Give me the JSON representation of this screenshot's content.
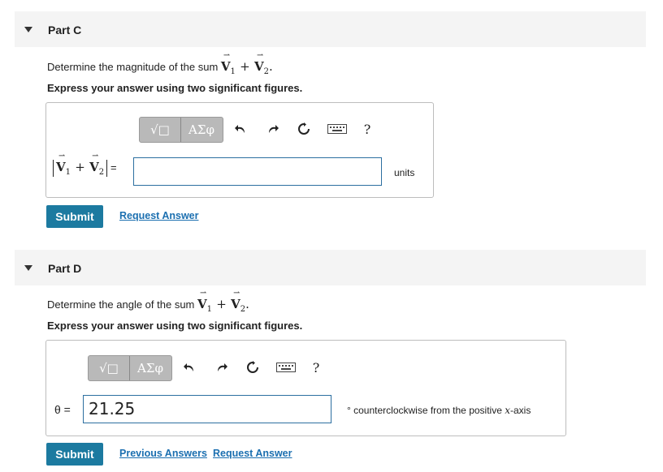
{
  "partC": {
    "title": "Part C",
    "prompt_prefix": "Determine the magnitude of the sum",
    "instruction": "Express your answer using two significant figures.",
    "toolbar": {
      "sqrt_label": "√□",
      "greek_label": "ΑΣφ",
      "help_label": "?"
    },
    "input_value": "",
    "units_label": "units",
    "submit_label": "Submit",
    "request_label": "Request Answer"
  },
  "partD": {
    "title": "Part D",
    "prompt_prefix": "Determine the angle of the sum",
    "instruction": "Express your answer using two significant figures.",
    "toolbar": {
      "sqrt_label": "√□",
      "greek_label": "ΑΣφ",
      "help_label": "?"
    },
    "theta_label": "θ =",
    "input_value": "21.25",
    "units_prefix": "° counterclockwise from the positive",
    "units_var": "x",
    "units_suffix": "-axis",
    "submit_label": "Submit",
    "previous_label": "Previous Answers",
    "request_label": "Request Answer"
  },
  "math": {
    "v1": "V",
    "v1_sub": "1",
    "v2": "V",
    "v2_sub": "2",
    "plus": "+",
    "period": ".",
    "arrow": "⇀",
    "equals": "="
  },
  "icons": [
    "triangle-down-icon",
    "undo-icon",
    "redo-icon",
    "reset-icon",
    "keyboard-icon",
    "help-icon"
  ]
}
